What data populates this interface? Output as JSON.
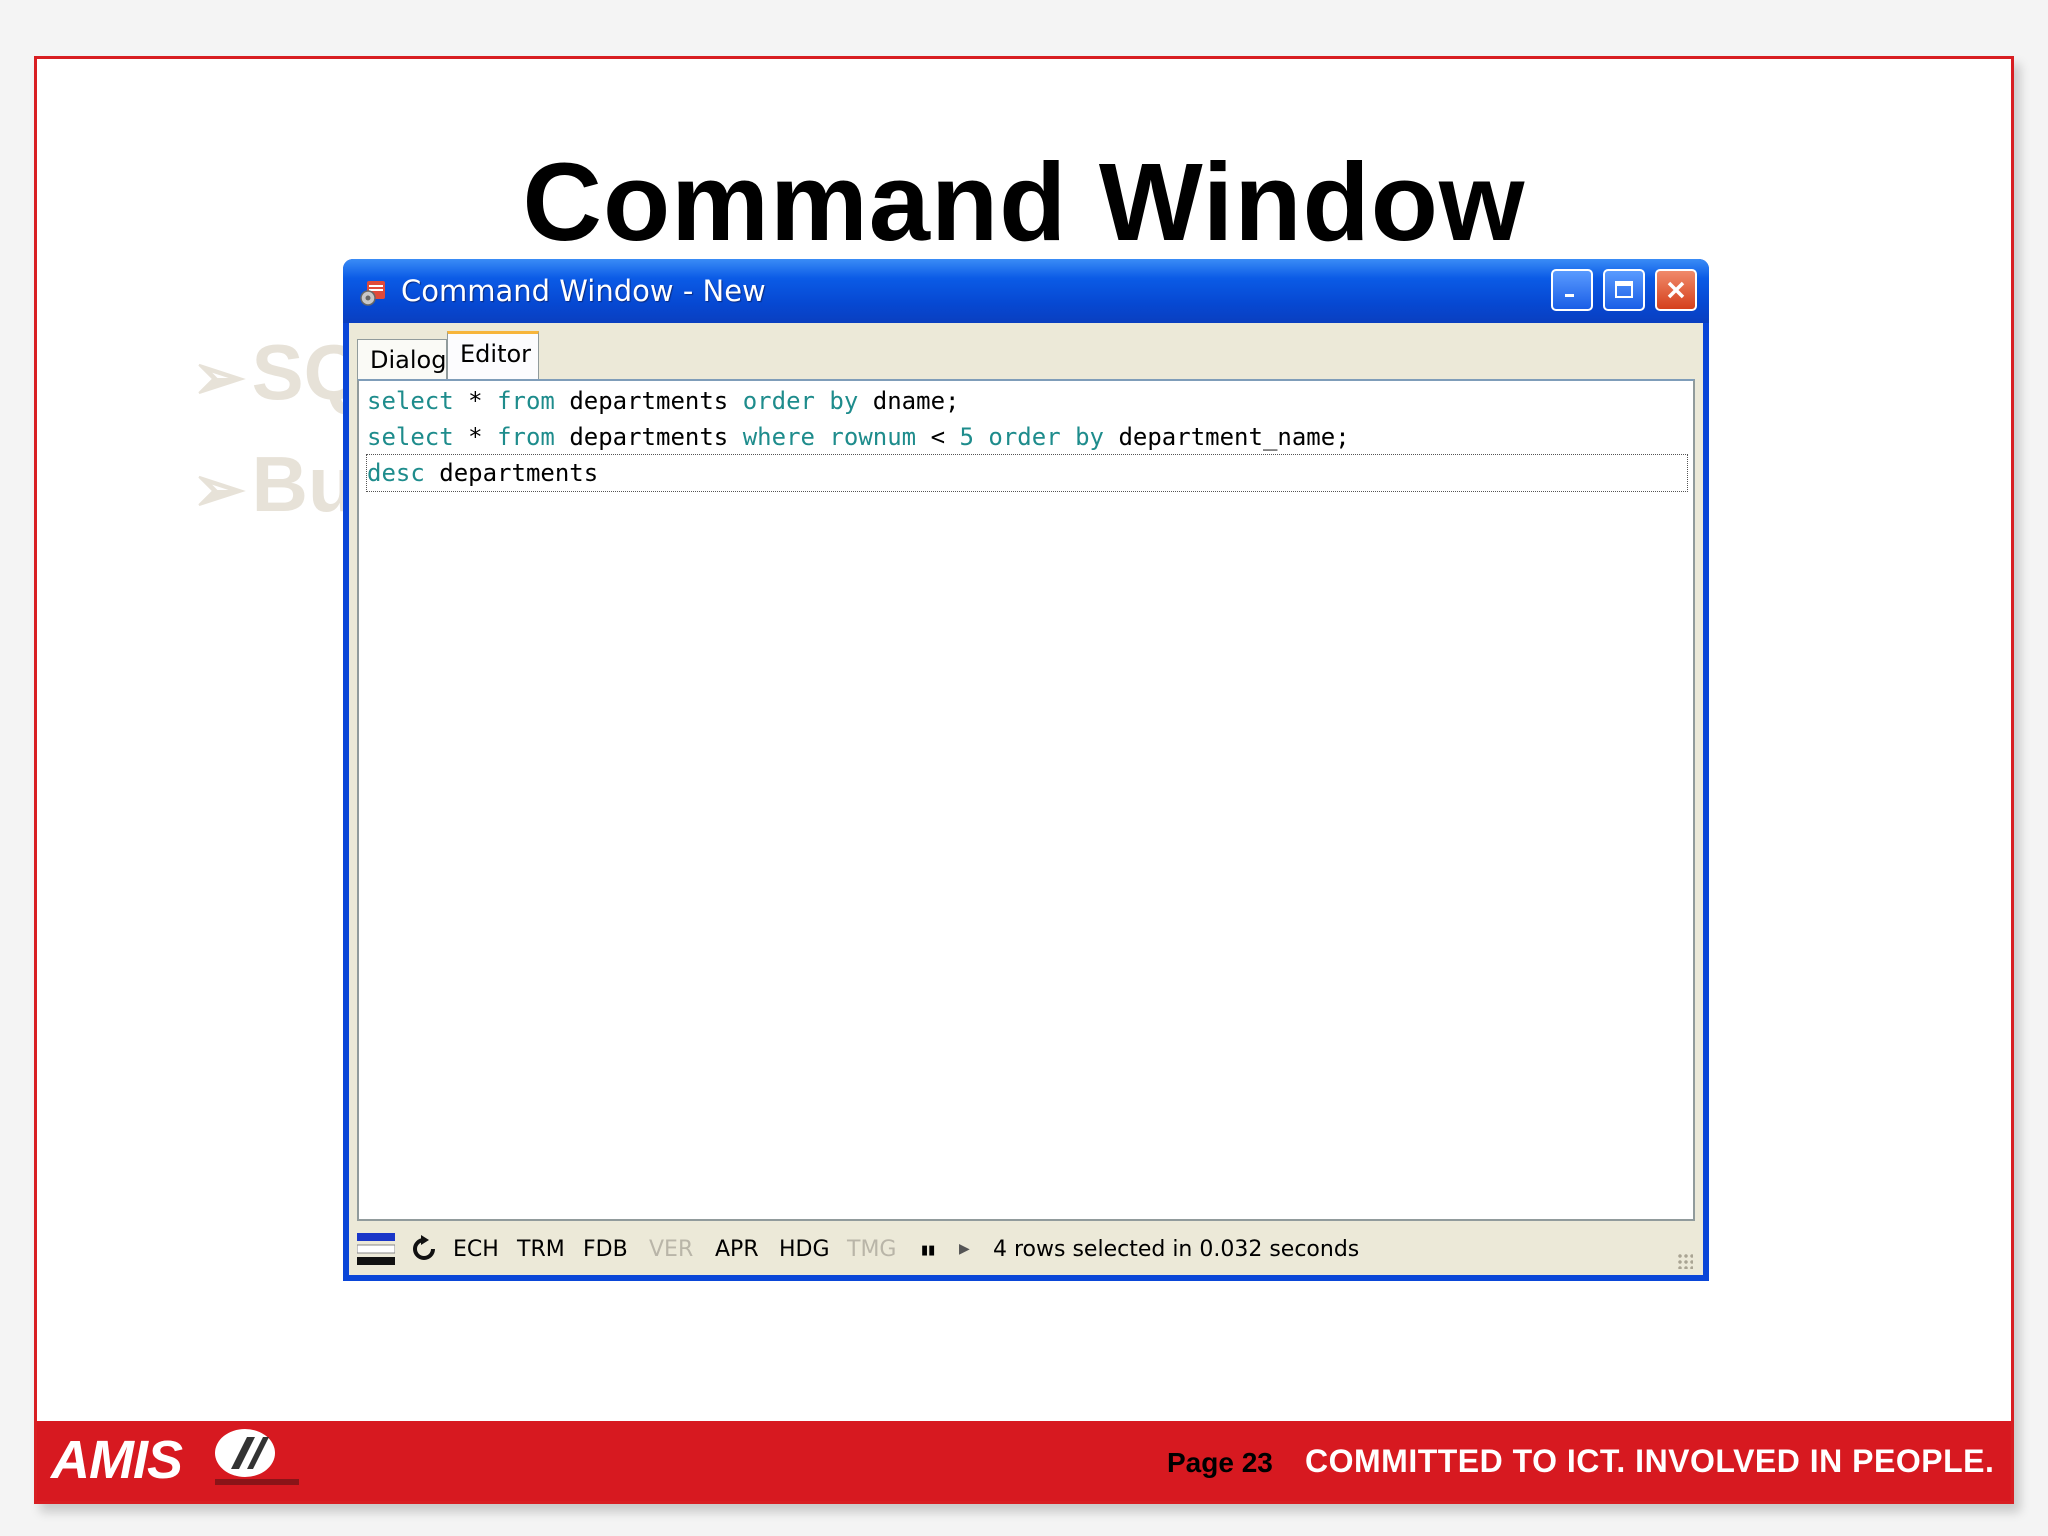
{
  "slide": {
    "title": "Command Window",
    "ghost_bullets": [
      {
        "marker": "➢",
        "text": "SQ"
      },
      {
        "marker": "➢",
        "text": "Bu"
      }
    ]
  },
  "window": {
    "title": "Command Window - New",
    "controls": {
      "minimize": "_",
      "maximize": "□",
      "close": "✕"
    },
    "tabs": [
      {
        "label": "Dialog",
        "active": false
      },
      {
        "label": "Editor",
        "active": true
      }
    ],
    "editor_lines": [
      "select * from departments order by dname;",
      "select * from departments where rownum < 5 order by department_name;",
      "desc departments"
    ],
    "status": {
      "toggles": [
        {
          "label": "ECH",
          "enabled": true
        },
        {
          "label": "TRM",
          "enabled": true
        },
        {
          "label": "FDB",
          "enabled": true
        },
        {
          "label": "VER",
          "enabled": false
        },
        {
          "label": "APR",
          "enabled": true
        },
        {
          "label": "HDG",
          "enabled": true
        },
        {
          "label": "TMG",
          "enabled": false
        }
      ],
      "pause_icon": "▮▮",
      "play_icon": "▶",
      "message": "4 rows selected in 0.032 seconds"
    }
  },
  "footer": {
    "logo_text": "AMIS",
    "page": "Page 23",
    "tagline": "COMMITTED TO ICT.  INVOLVED IN PEOPLE."
  },
  "colors": {
    "border_red": "#d81e22",
    "footer_red": "#d71920",
    "titlebar_blue": "#0648d2",
    "keyword_teal": "#1e8c8c"
  }
}
